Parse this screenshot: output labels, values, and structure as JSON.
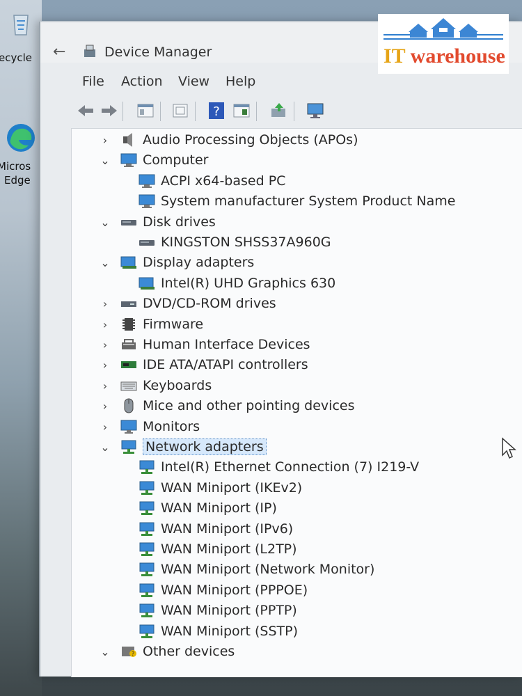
{
  "desktop": {
    "recycle_label": "ecycle",
    "edge_label_1": "Micros",
    "edge_label_2": "Edge"
  },
  "window": {
    "title": "Device Manager"
  },
  "menu": [
    "File",
    "Action",
    "View",
    "Help"
  ],
  "toolbar_icons": [
    "back-icon",
    "forward-icon",
    "properties-icon",
    "show-hidden-icon",
    "help-icon",
    "view-icon",
    "update-driver-icon",
    "monitor-icon"
  ],
  "tree": [
    {
      "label": "Audio Processing Objects (APOs)",
      "level": 0,
      "expanded": false,
      "icon": "speaker-icon"
    },
    {
      "label": "Computer",
      "level": 0,
      "expanded": true,
      "icon": "computer-icon"
    },
    {
      "label": "ACPI x64-based PC",
      "level": 1,
      "icon": "computer-icon"
    },
    {
      "label": "System manufacturer System Product Name",
      "level": 1,
      "icon": "computer-icon"
    },
    {
      "label": "Disk drives",
      "level": 0,
      "expanded": true,
      "icon": "disk-icon"
    },
    {
      "label": "KINGSTON SHSS37A960G",
      "level": 1,
      "icon": "disk-icon"
    },
    {
      "label": "Display adapters",
      "level": 0,
      "expanded": true,
      "icon": "display-adapter-icon"
    },
    {
      "label": "Intel(R) UHD Graphics 630",
      "level": 1,
      "icon": "display-adapter-icon"
    },
    {
      "label": "DVD/CD-ROM drives",
      "level": 0,
      "expanded": false,
      "icon": "dvd-icon"
    },
    {
      "label": "Firmware",
      "level": 0,
      "expanded": false,
      "icon": "firmware-icon"
    },
    {
      "label": "Human Interface Devices",
      "level": 0,
      "expanded": false,
      "icon": "hid-icon"
    },
    {
      "label": "IDE ATA/ATAPI controllers",
      "level": 0,
      "expanded": false,
      "icon": "ide-icon"
    },
    {
      "label": "Keyboards",
      "level": 0,
      "expanded": false,
      "icon": "keyboard-icon"
    },
    {
      "label": "Mice and other pointing devices",
      "level": 0,
      "expanded": false,
      "icon": "mouse-icon"
    },
    {
      "label": "Monitors",
      "level": 0,
      "expanded": false,
      "icon": "monitor-icon"
    },
    {
      "label": "Network adapters",
      "level": 0,
      "expanded": true,
      "selected": true,
      "icon": "network-icon"
    },
    {
      "label": "Intel(R) Ethernet Connection (7) I219-V",
      "level": 1,
      "icon": "network-icon"
    },
    {
      "label": "WAN Miniport (IKEv2)",
      "level": 1,
      "icon": "network-icon"
    },
    {
      "label": "WAN Miniport (IP)",
      "level": 1,
      "icon": "network-icon"
    },
    {
      "label": "WAN Miniport (IPv6)",
      "level": 1,
      "icon": "network-icon"
    },
    {
      "label": "WAN Miniport (L2TP)",
      "level": 1,
      "icon": "network-icon"
    },
    {
      "label": "WAN Miniport (Network Monitor)",
      "level": 1,
      "icon": "network-icon"
    },
    {
      "label": "WAN Miniport (PPPOE)",
      "level": 1,
      "icon": "network-icon"
    },
    {
      "label": "WAN Miniport (PPTP)",
      "level": 1,
      "icon": "network-icon"
    },
    {
      "label": "WAN Miniport (SSTP)",
      "level": 1,
      "icon": "network-icon"
    },
    {
      "label": "Other devices",
      "level": 0,
      "expanded": true,
      "icon": "other-devices-icon"
    }
  ],
  "logo": {
    "it": "IT",
    "rest": " warehouse"
  },
  "colors": {
    "accent_blue": "#2f7fd0",
    "logo_orange": "#e24a2e",
    "logo_gold": "#e6a416"
  }
}
